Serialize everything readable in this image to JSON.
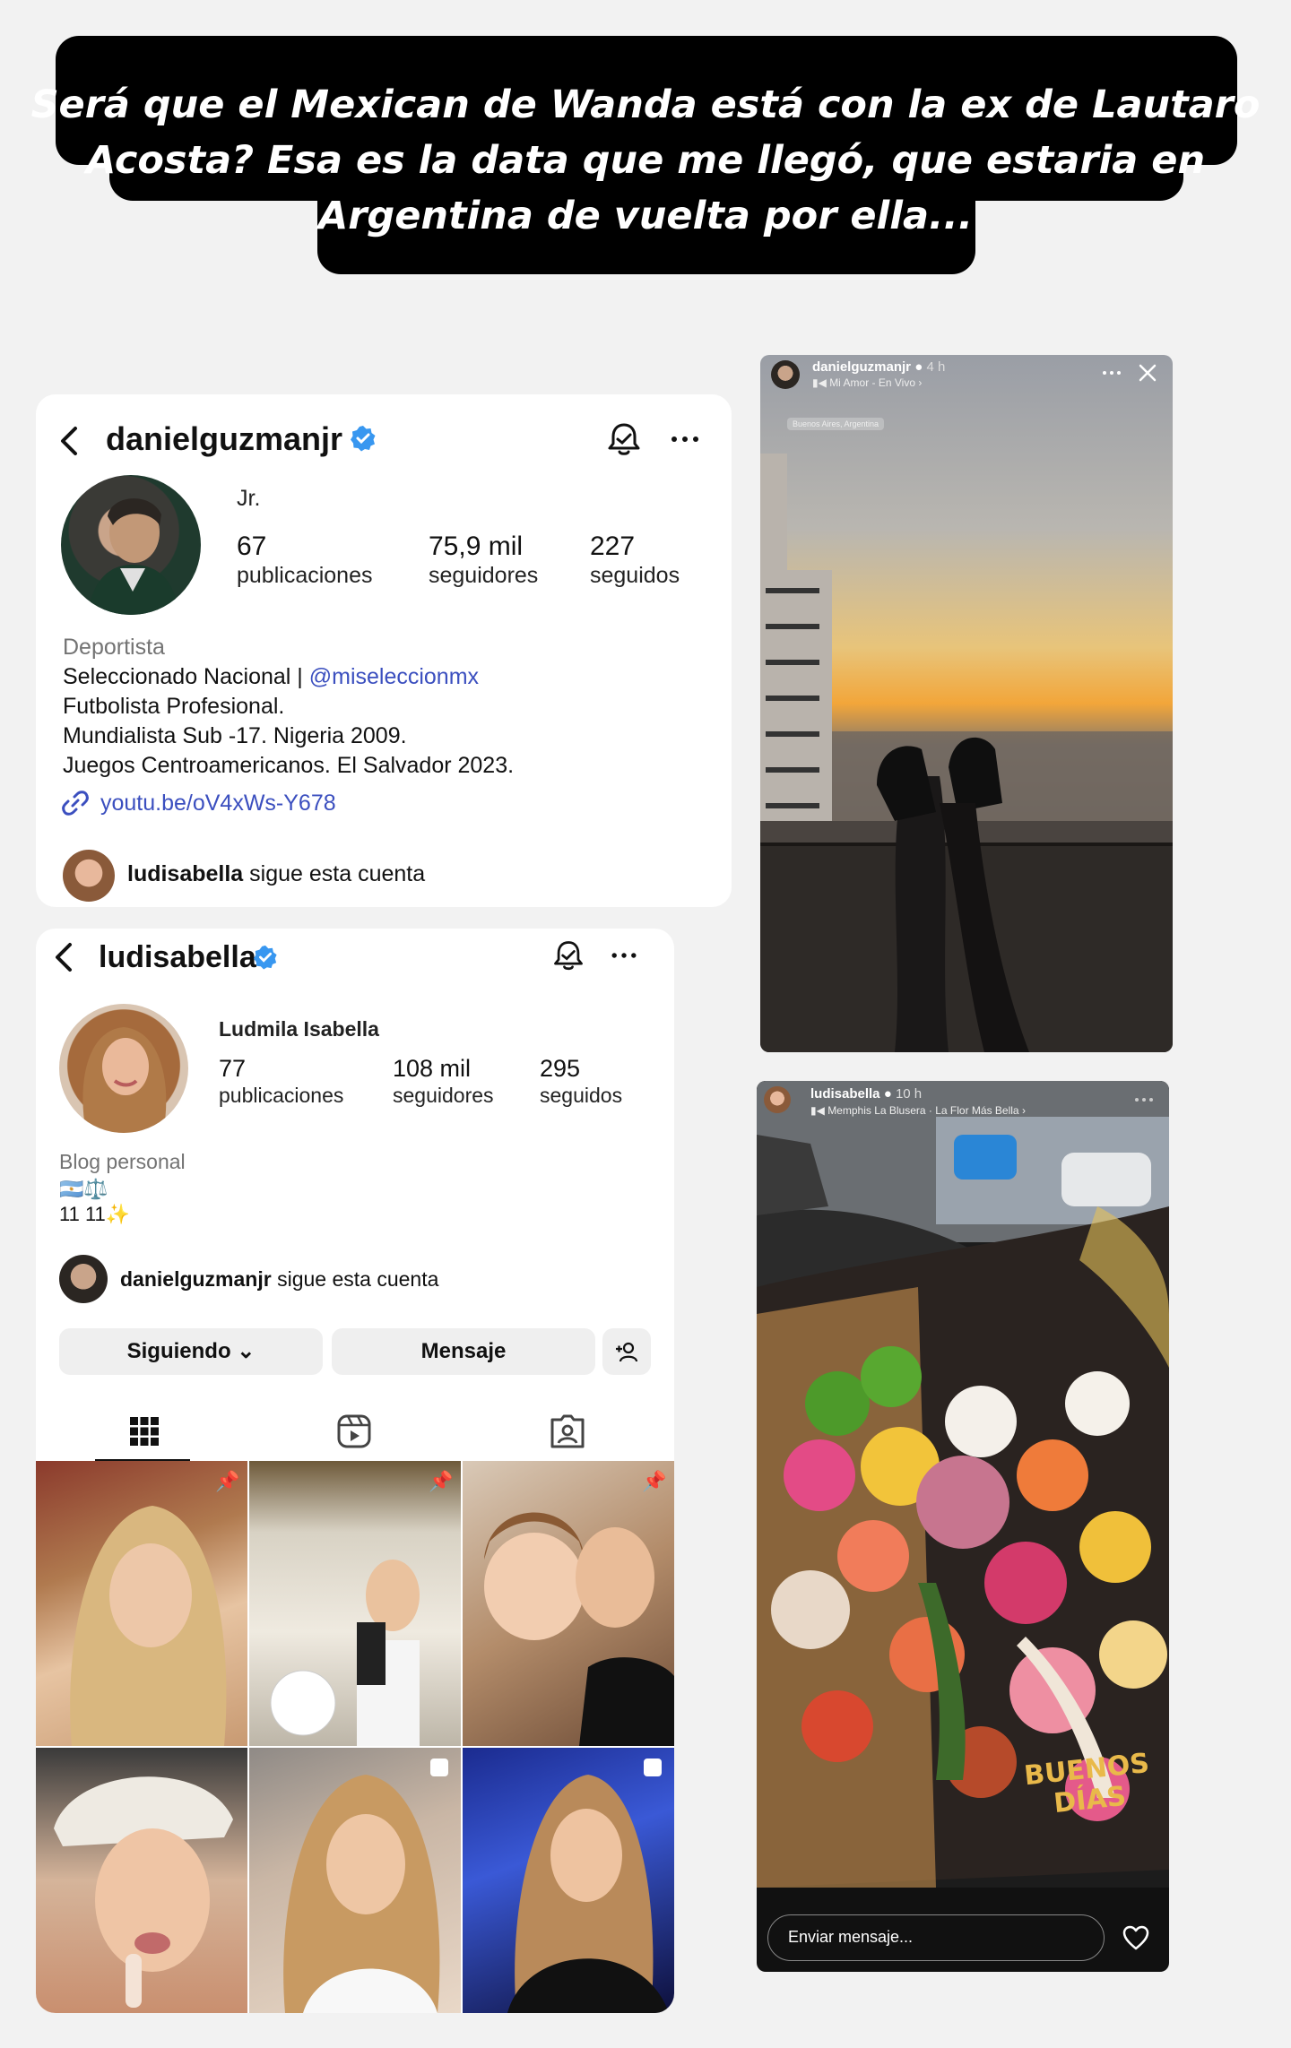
{
  "caption": {
    "line1": "Será que el Mexican de Wanda está con la ex de Lautaro",
    "line2": "Acosta? Esa es la data que me llegó, que estaria en",
    "line3": "Argentina de vuelta por ella..."
  },
  "profile1": {
    "username": "danielguzmanjr",
    "name": "Jr.",
    "stats": [
      {
        "value": "67",
        "label": "publicaciones"
      },
      {
        "value": "75,9 mil",
        "label": "seguidores"
      },
      {
        "value": "227",
        "label": "seguidos"
      }
    ],
    "category": "Deportista",
    "bio_line1_prefix": "Seleccionado Nacional | ",
    "bio_line1_mention": "@miseleccionmx",
    "bio_line2": "Futbolista Profesional.",
    "bio_line3": "Mundialista Sub -17. Nigeria 2009.",
    "bio_line4": "Juegos Centroamericanos. El Salvador 2023.",
    "link": "youtu.be/oV4xWs-Y678",
    "followed_by_user": "ludisabella",
    "followed_by_text": " sigue esta cuenta"
  },
  "profile2": {
    "username": "ludisabella",
    "name": "Ludmila Isabella",
    "stats": [
      {
        "value": "77",
        "label": "publicaciones"
      },
      {
        "value": "108 mil",
        "label": "seguidores"
      },
      {
        "value": "295",
        "label": "seguidos"
      }
    ],
    "category": "Blog personal",
    "bio_line1": "🇦🇷⚖️",
    "bio_line2": "11 11✨",
    "followed_by_user": "danielguzmanjr",
    "followed_by_text": " sigue esta cuenta",
    "buttons": {
      "following": "Siguiendo",
      "message": "Mensaje"
    }
  },
  "story1": {
    "username": "danielguzmanjr",
    "time": "4 h",
    "music": "Mi Amor - En Vivo",
    "location": "Buenos Aires, Argentina"
  },
  "story2": {
    "username": "ludisabella",
    "time": "10 h",
    "music": "Memphis La Blusera · La Flor Más Bella",
    "reply_placeholder": "Enviar mensaje...",
    "overlay_text_1": "BUENOS",
    "overlay_text_2": "DÍAS"
  },
  "colors": {
    "verified": "#3897f0",
    "link": "#3b4fbf",
    "caption_bg": "#000000"
  }
}
